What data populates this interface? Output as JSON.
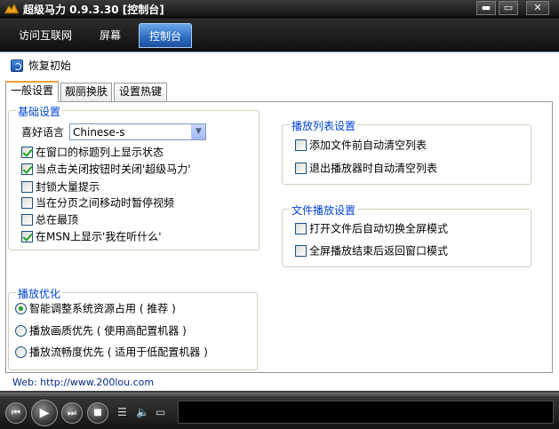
{
  "window": {
    "title": "超级马力 0.9.3.30  [控制台]",
    "min_glyph": "▬",
    "max_glyph": "▭",
    "close_glyph": "✕"
  },
  "topnav": {
    "tabs": [
      {
        "label": "访问互联网"
      },
      {
        "label": "屏幕"
      },
      {
        "label": "控制台",
        "active": true
      }
    ]
  },
  "toolbar": {
    "restore_label": "恢复初始"
  },
  "settings_tabs": [
    {
      "label": "一般设置",
      "active": true
    },
    {
      "label": "靓丽换肤"
    },
    {
      "label": "设置热键"
    }
  ],
  "basic": {
    "title": "基础设置",
    "language_label": "喜好语言",
    "language_value": "Chinese-s",
    "options": [
      {
        "label": "在窗口的标题列上显示状态",
        "checked": true
      },
      {
        "label": "当点击关闭按钮时关闭'超级马力'",
        "checked": true
      },
      {
        "label": "封锁大量提示",
        "checked": false
      },
      {
        "label": "当在分页之间移动时暂停视频",
        "checked": false
      },
      {
        "label": "总在最顶",
        "checked": false
      },
      {
        "label": "在MSN上显示'我在听什么'",
        "checked": true
      }
    ]
  },
  "playlist": {
    "title": "播放列表设置",
    "options": [
      {
        "label": "添加文件前自动清空列表",
        "checked": false
      },
      {
        "label": "退出播放器时自动清空列表",
        "checked": false
      }
    ]
  },
  "file_play": {
    "title": "文件播放设置",
    "options": [
      {
        "label": "打开文件后自动切换全屏模式",
        "checked": false
      },
      {
        "label": "全屏播放结束后返回窗口模式",
        "checked": false
      }
    ]
  },
  "optimize": {
    "title": "播放优化",
    "options": [
      {
        "label": "智能调整系统资源占用 ( 推荐 )",
        "checked": true
      },
      {
        "label": "播放画质优先 ( 使用高配置机器 )",
        "checked": false
      },
      {
        "label": "播放流畅度优先 ( 适用于低配置机器 )",
        "checked": false
      }
    ]
  },
  "footer": {
    "web": "Web: http://www.200lou.com"
  },
  "player": {
    "prev_glyph": "⏮",
    "play_glyph": "▶",
    "next_glyph": "⏭",
    "stop_glyph": "■",
    "list_glyph": "☰",
    "volume_glyph": "🔈",
    "screen_glyph": "▭"
  },
  "colors": {
    "accent": "#2c6bc4",
    "legend_blue": "#0046d5",
    "check_green": "#21a121",
    "tab_highlight": "#f0a040"
  }
}
